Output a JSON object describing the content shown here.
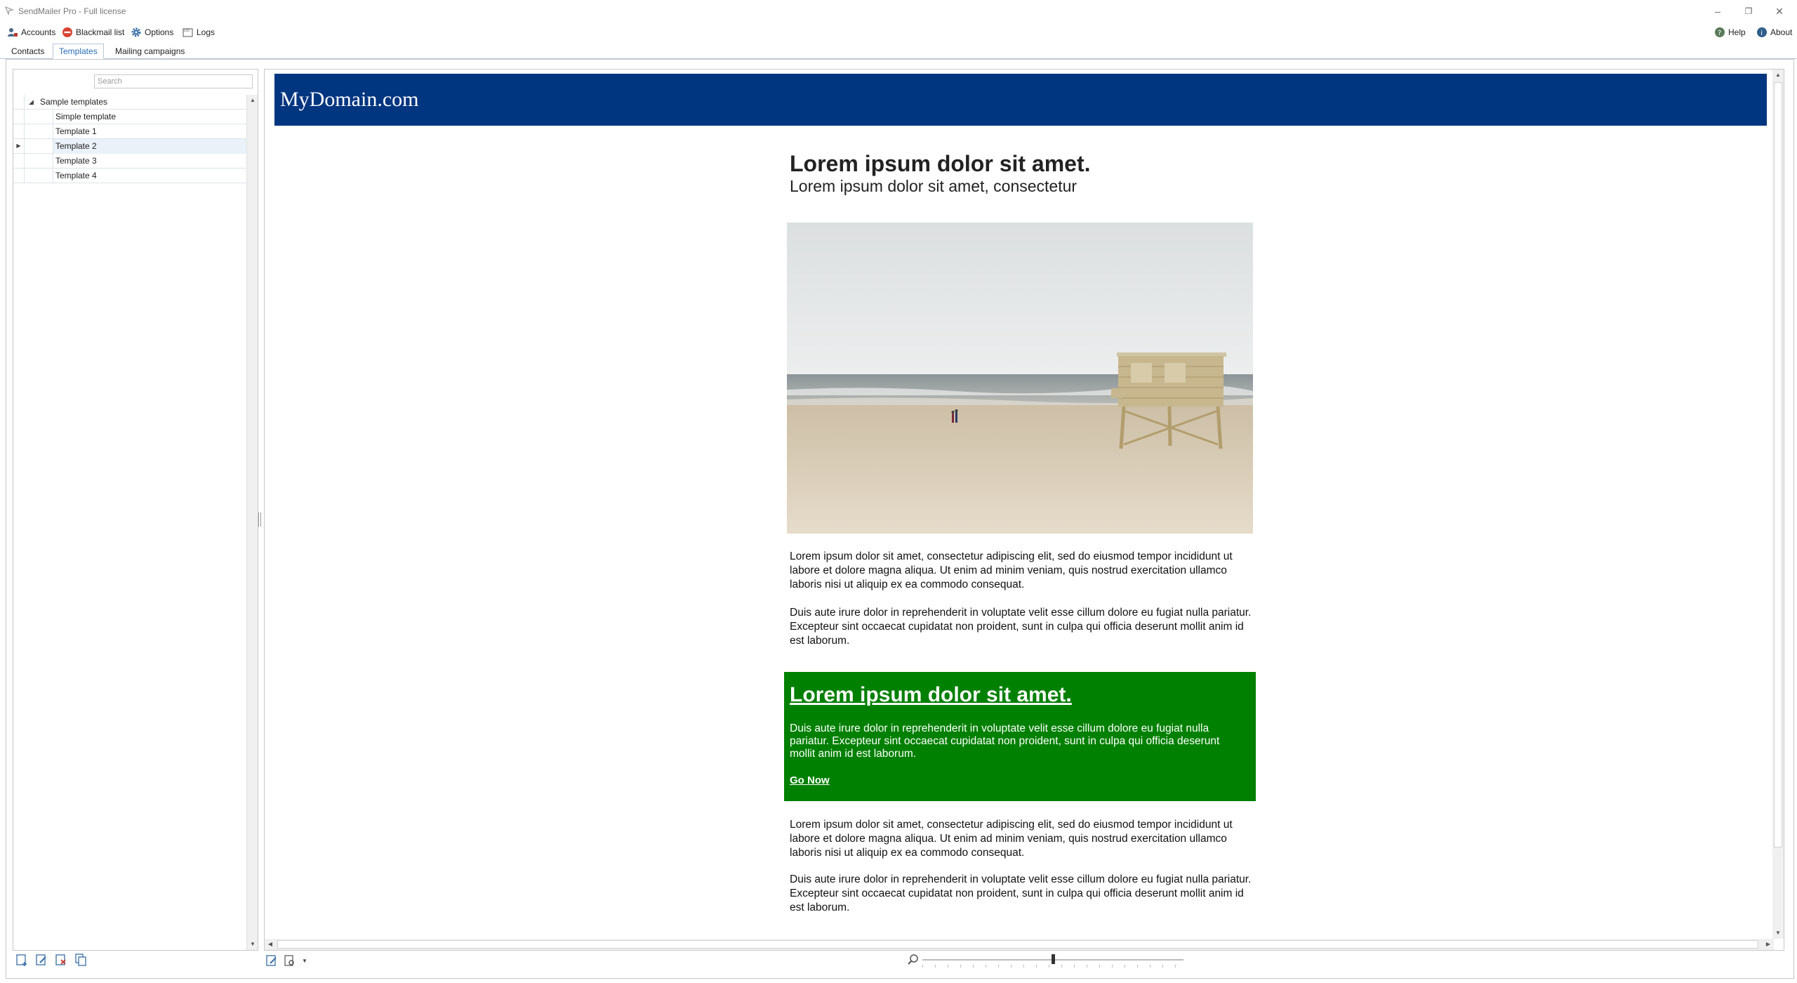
{
  "window": {
    "title": "SendMailer Pro - Full license",
    "minimize_glyph": "–",
    "restore_glyph": "❐",
    "close_glyph": "✕"
  },
  "toolbar": {
    "accounts": "Accounts",
    "blackmail": "Blackmail list",
    "options": "Options",
    "logs": "Logs",
    "help": "Help",
    "about": "About"
  },
  "tabs": [
    {
      "label": "Contacts"
    },
    {
      "label": "Templates"
    },
    {
      "label": "Mailing campaigns"
    }
  ],
  "left": {
    "search_placeholder": "Search",
    "tree_root": "Sample templates",
    "items": [
      {
        "label": "Simple template"
      },
      {
        "label": "Template 1"
      },
      {
        "label": "Template 2"
      },
      {
        "label": "Template 3"
      },
      {
        "label": "Template 4"
      }
    ]
  },
  "email": {
    "brand": "MyDomain.com",
    "headline": "Lorem ipsum dolor sit amet.",
    "subheadline": "Lorem ipsum dolor sit amet, consectetur",
    "para1": "Lorem ipsum dolor sit amet, consectetur adipiscing elit, sed do eiusmod tempor incididunt ut labore et dolore magna aliqua. Ut enim ad minim veniam, quis nostrud exercitation ullamco laboris nisi ut aliquip ex ea commodo consequat.",
    "para2": "Duis aute irure dolor in reprehenderit in voluptate velit esse cillum dolore eu fugiat nulla pariatur. Excepteur sint occaecat cupidatat non proident, sunt in culpa qui officia deserunt mollit anim id est laborum.",
    "cta_title": "Lorem ipsum dolor sit amet.",
    "cta_text": "Duis aute irure dolor in reprehenderit in voluptate velit esse cillum dolore eu fugiat nulla pariatur. Excepteur sint occaecat cupidatat non proident, sunt in culpa qui officia deserunt mollit anim id est laborum.",
    "cta_link": "Go Now",
    "para3": "Lorem ipsum dolor sit amet, consectetur adipiscing elit, sed do eiusmod tempor incididunt ut labore et dolore magna aliqua. Ut enim ad minim veniam, quis nostrud exercitation ullamco laboris nisi ut aliquip ex ea commodo consequat.",
    "para4": "Duis aute irure dolor in reprehenderit in voluptate velit esse cillum dolore eu fugiat nulla pariatur. Excepteur sint occaecat cupidatat non proident, sunt in culpa qui officia deserunt mollit anim id est laborum."
  },
  "zoom": {
    "level": 0.5
  },
  "colors": {
    "header_blue": "#003580",
    "cta_green": "#008000",
    "active_tab_text": "#2a6ebb"
  },
  "icons": [
    "accounts-icon",
    "blackmail-icon",
    "options-gear-icon",
    "logs-icon",
    "help-icon",
    "about-icon",
    "new-template-icon",
    "edit-template-icon",
    "delete-template-icon",
    "copy-template-icon",
    "edit-html-icon",
    "preview-options-icon",
    "zoom-icon",
    "beach-photo"
  ]
}
